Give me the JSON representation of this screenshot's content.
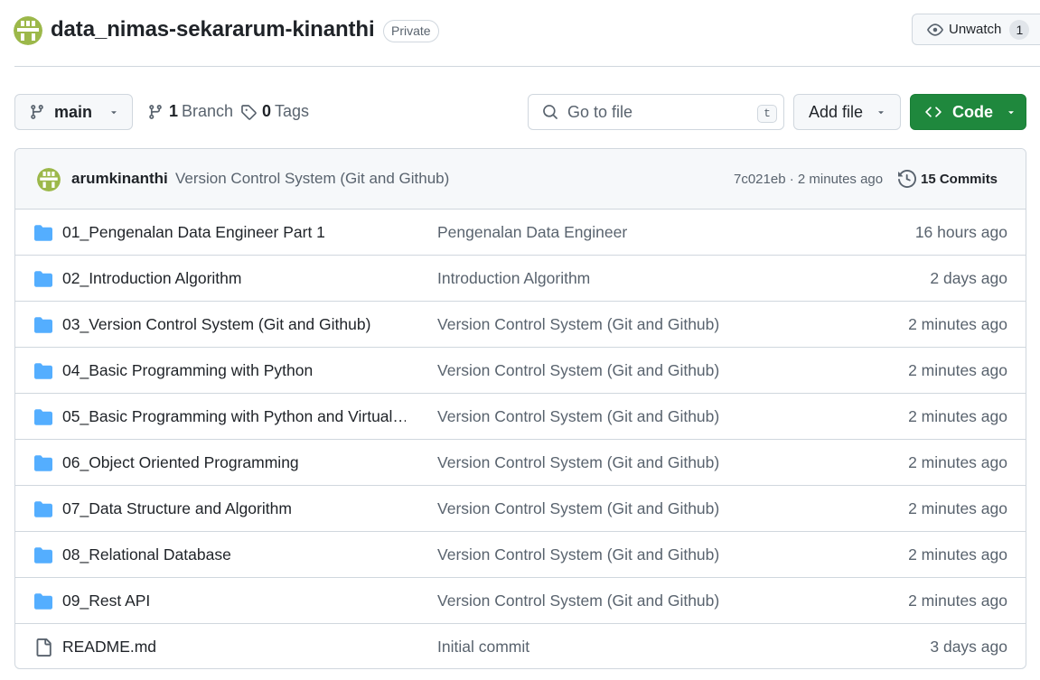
{
  "repo": {
    "name": "data_nimas-sekararum-kinanthi",
    "visibility": "Private",
    "unwatch_label": "Unwatch",
    "watch_count": "1"
  },
  "toolbar": {
    "branch_name": "main",
    "branch_count": "1",
    "branch_label": "Branch",
    "tag_count": "0",
    "tag_label": "Tags",
    "search_placeholder": "Go to file",
    "search_shortcut": "t",
    "add_file_label": "Add file",
    "code_label": "Code"
  },
  "latest_commit": {
    "author": "arumkinanthi",
    "message": "Version Control System (Git and Github)",
    "meta": "7c021eb · 2 minutes ago",
    "commits_label": "15 Commits"
  },
  "files": [
    {
      "type": "folder",
      "name": "01_Pengenalan Data Engineer Part 1",
      "message": "Pengenalan Data Engineer",
      "age": "16 hours ago"
    },
    {
      "type": "folder",
      "name": "02_Introduction Algorithm",
      "message": "Introduction Algorithm",
      "age": "2 days ago"
    },
    {
      "type": "folder",
      "name": "03_Version Control System (Git and Github)",
      "message": "Version Control System (Git and Github)",
      "age": "2 minutes ago"
    },
    {
      "type": "folder",
      "name": "04_Basic Programming with Python",
      "message": "Version Control System (Git and Github)",
      "age": "2 minutes ago"
    },
    {
      "type": "folder",
      "name": "05_Basic Programming with Python and Virtual…",
      "message": "Version Control System (Git and Github)",
      "age": "2 minutes ago"
    },
    {
      "type": "folder",
      "name": "06_Object Oriented Programming",
      "message": "Version Control System (Git and Github)",
      "age": "2 minutes ago"
    },
    {
      "type": "folder",
      "name": "07_Data Structure and Algorithm",
      "message": "Version Control System (Git and Github)",
      "age": "2 minutes ago"
    },
    {
      "type": "folder",
      "name": "08_Relational Database",
      "message": "Version Control System (Git and Github)",
      "age": "2 minutes ago"
    },
    {
      "type": "folder",
      "name": "09_Rest API",
      "message": "Version Control System (Git and Github)",
      "age": "2 minutes ago"
    },
    {
      "type": "file",
      "name": "README.md",
      "message": "Initial commit",
      "age": "3 days ago"
    }
  ],
  "colors": {
    "folder": "#54aeff",
    "primary_button": "#1f883d",
    "avatar": "#9cb84a"
  },
  "icons": {
    "folder": "folder-icon",
    "file": "file-icon",
    "branch": "git-branch-icon",
    "tag": "tag-icon",
    "search": "search-icon",
    "eye": "eye-icon",
    "code": "code-icon",
    "history": "history-icon",
    "caret": "triangle-down-icon"
  }
}
